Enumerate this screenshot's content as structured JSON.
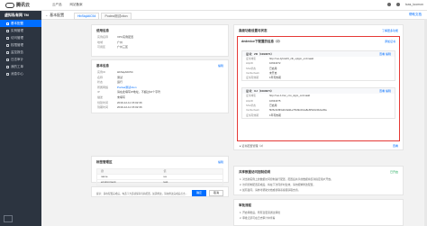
{
  "brand": {
    "name": "腾讯云"
  },
  "topnav": [
    "云产品",
    "网站备案"
  ],
  "topright": {
    "user": "tcas_toomon"
  },
  "sidebar": {
    "title": "虚拟私有网 TM",
    "items": [
      "基本配置",
      "实例管理",
      "访问管理",
      "权限管理",
      "监控报告",
      "日志审计",
      "我的工单",
      "消息中心"
    ]
  },
  "tabbar": {
    "back": "← 基本配置",
    "tabs": [
      "HbStqA6C54",
      "Poclea测试ction"
    ],
    "help": "帮助文档"
  },
  "left_panels": {
    "p1": {
      "title": "使用信息",
      "rows": [
        {
          "k": "实例名称",
          "v": "VPC实例配置"
        },
        {
          "k": "地域",
          "v": "广州"
        },
        {
          "k": "可用区",
          "v": "广州三区"
        }
      ]
    },
    "p2": {
      "title": "基本信息",
      "edit": "编辑",
      "rows": [
        {
          "k": "实例ID",
          "v": "HbStqA6C54"
        },
        {
          "k": "名称",
          "v": "测试"
        },
        {
          "k": "状态",
          "v": "运行"
        },
        {
          "k": "所属网络",
          "v": "Poclea测试ction"
        },
        {
          "k": "IP",
          "v": "请在此填写IP地址，不超过16个字符"
        },
        {
          "k": "描述",
          "v": "未填写"
        },
        {
          "k": "创建时间",
          "v": "2019-12-11 15:02:36"
        },
        {
          "k": "到期时间",
          "v": "2019-12-11 15:02:36"
        }
      ]
    },
    "p3": {
      "title": "标签管理区",
      "edit": "编辑",
      "headers": [
        "键",
        "值"
      ],
      "rows": [
        [
          "name",
          "ua"
        ],
        [
          "environment",
          "test"
        ]
      ]
    },
    "p4": {
      "note": "提示：请在配置完成后，勾选下方选项保存当前配置，如需修改，请在修改完成后点击确定重新提交。",
      "ok": "确定",
      "cancel": "取消"
    }
  },
  "right_panels": {
    "top": {
      "title": "高级功能设置与状态",
      "link": "了解更多功能"
    },
    "red": {
      "header": "dedevice下配置的信息（2）",
      "add": "添加证书",
      "cards": [
        {
          "title": "证书：ZD（1093071）",
          "acts": "查看  编辑",
          "rows": [
            {
              "k": "证书域名",
              "v": "http://ruo-1jhnsh6_clb_oplgm_onzmaab"
            },
            {
              "k": "HttpID",
              "v": "10634072"
            },
            {
              "k": "SSL状态",
              "v": "已启用"
            },
            {
              "k": "Verifierhash",
              "v": "未开启"
            },
            {
              "k": "证书有效期",
              "v": "1年有效期"
            }
          ]
        },
        {
          "title": "证书：UJ（1093074）",
          "acts": "查看  编辑",
          "rows": [
            {
              "k": "证书域名",
              "v": "http://ruo-1-hsc_cnx_slgm_onzmaab"
            },
            {
              "k": "HttpID",
              "v": "10634075"
            },
            {
              "k": "SSL状态",
              "v": "已启用"
            },
            {
              "k": "Verifierhash",
              "v": "5bf6c1b8f4d2c3a91e7f0d9c2b1a8e6f5d4c3b2a1f0e"
            },
            {
              "k": "证书有效期",
              "v": "1年有效期"
            }
          ]
        }
      ]
    },
    "below": {
      "text": "▸ 证书配置管理（2）",
      "link": "查看"
    },
    "mid": {
      "title": "共享数据访问控制说明",
      "badge": "已开启",
      "lines": [
        "1. 对当前实例上的数据访问控制进行配置，配置后共享的数据将仅对指定用户开放。",
        "2. 访问控制配置完成后，将在下次同步时生效，请勿频繁修改配置。",
        "3. 如有疑问，请参考帮助文档或者联系客服获取支持。"
      ]
    },
    "bottom": {
      "title": "审批流程",
      "lines": [
        "1. 开启审批后，所有变更需通过审批",
        "2. 审批记录可在日志审计中查看"
      ]
    }
  },
  "colors": {
    "accent": "#006eff",
    "highlight": "#e53935",
    "sidebar": "#2c3440",
    "ok": "#22a95c"
  }
}
